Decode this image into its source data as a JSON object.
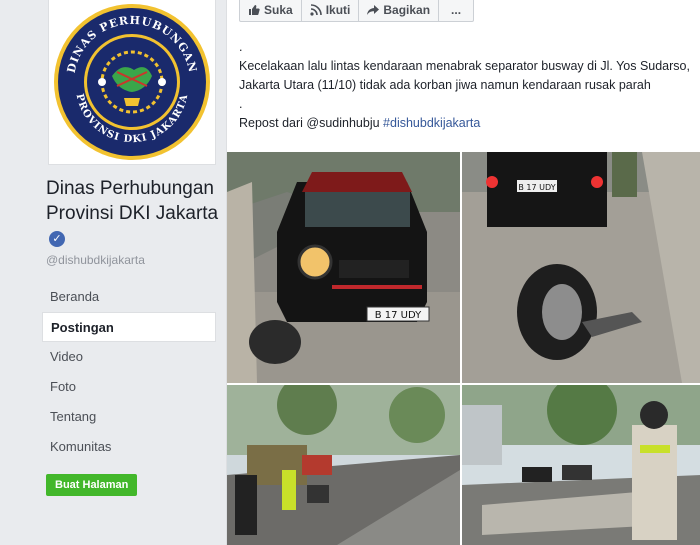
{
  "sidebar": {
    "page_name": "Dinas Perhubungan Provinsi DKI Jakarta",
    "handle": "@dishubdkijakarta",
    "logo_text_top": "DINAS PERHUBUNGAN",
    "logo_text_bottom": "PROVINSI DKI JAKARTA",
    "nav": [
      {
        "label": "Beranda"
      },
      {
        "label": "Postingan"
      },
      {
        "label": "Video"
      },
      {
        "label": "Foto"
      },
      {
        "label": "Tentang"
      },
      {
        "label": "Komunitas"
      }
    ],
    "create_page_label": "Buat Halaman"
  },
  "post": {
    "actions": {
      "like": "Suka",
      "follow": "Ikuti",
      "share": "Bagikan",
      "more": "..."
    },
    "dot1": ".",
    "body": "Kecelakaan lalu lintas kendaraan menabrak separator busway di Jl. Yos Sudarso, Jakarta Utara (11/10) tidak ada korban jiwa namun kendaraan rusak parah",
    "dot2": ".",
    "repost_prefix": "Repost dari @sudinhubju",
    "hashtag": "#dishubdkijakarta",
    "plates": {
      "front": "B 17 UDY",
      "rear": "B 17 UDY"
    }
  },
  "colors": {
    "accent": "#4267b2",
    "link": "#365899",
    "create_button": "#42b72a"
  }
}
